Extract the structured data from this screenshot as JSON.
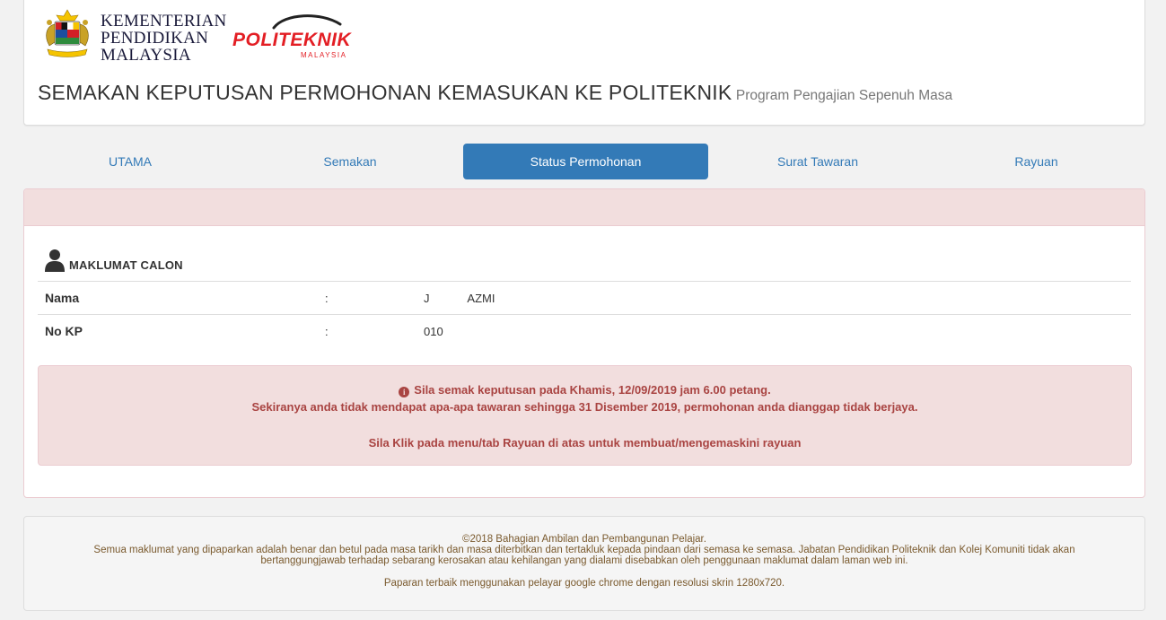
{
  "header": {
    "ministry_lines": [
      "KEMENTERIAN",
      "PENDIDIKAN",
      "MALAYSIA"
    ],
    "poli_logo_text": "POLITEKNIK",
    "poli_logo_subtext": "MALAYSIA",
    "title": "SEMAKAN KEPUTUSAN PERMOHONAN KEMASUKAN KE POLITEKNIK",
    "subtitle": "Program Pengajian Sepenuh Masa"
  },
  "nav": {
    "items": [
      {
        "label": "UTAMA",
        "active": false
      },
      {
        "label": "Semakan",
        "active": false
      },
      {
        "label": "Status Permohonan",
        "active": true
      },
      {
        "label": "Surat Tawaran",
        "active": false
      },
      {
        "label": "Rayuan",
        "active": false
      }
    ]
  },
  "candidate": {
    "section_title": "MAKLUMAT CALON",
    "rows": [
      {
        "label": "Nama",
        "sep": ":",
        "value": "J                AZMI"
      },
      {
        "label": "No KP",
        "sep": ":",
        "value": "010"
      }
    ]
  },
  "alert": {
    "line1": "Sila semak keputusan pada Khamis, 12/09/2019 jam 6.00 petang.",
    "line2": "Sekiranya anda tidak mendapat apa-apa tawaran sehingga 31 Disember 2019, permohonan anda dianggap tidak berjaya.",
    "line3": "Sila Klik pada menu/tab Rayuan di atas untuk membuat/mengemaskini rayuan",
    "icon": "info-circle-icon"
  },
  "footer": {
    "line1": "©2018 Bahagian Ambilan dan Pembangunan Pelajar.",
    "line2": "Semua maklumat yang dipaparkan adalah benar dan betul pada masa tarikh dan masa diterbitkan dan tertakluk kepada pindaan dari semasa ke semasa. Jabatan Pendidikan Politeknik dan Kolej Komuniti tidak akan",
    "line3": "bertanggungjawab terhadap sebarang kerosakan atau kehilangan yang dialami disebabkan oleh penggunaan maklumat dalam laman web ini.",
    "line4": "Paparan terbaik menggunakan pelayar google chrome dengan resolusi skrin 1280x720."
  },
  "colors": {
    "primary": "#337ab7",
    "danger_bg": "#f2dede",
    "danger_text": "#a94442",
    "poli_red": "#e31e24"
  }
}
